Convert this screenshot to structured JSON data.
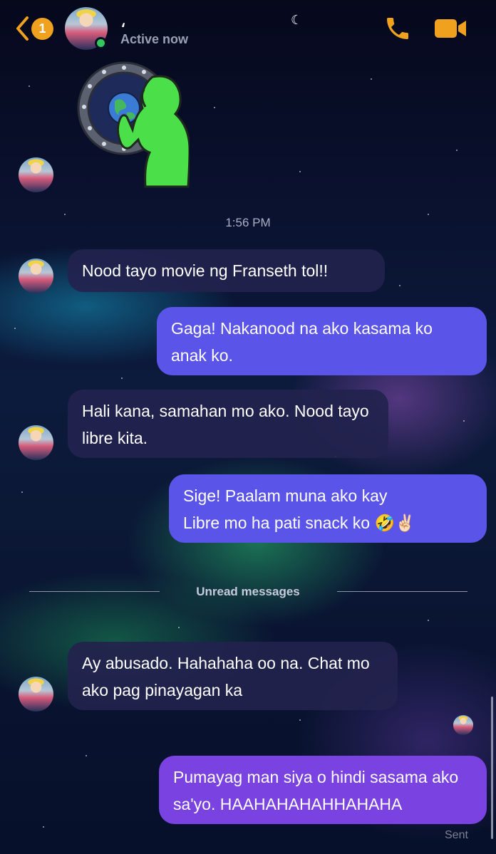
{
  "header": {
    "unread_count": "1",
    "contact_name": "⸲",
    "status": "Active now",
    "moon": "☾",
    "back_icon": "chevron-left-icon",
    "call_icon": "phone-icon",
    "video_icon": "video-camera-icon",
    "accent_color": "#f0a11e"
  },
  "timestamp": "1:56 PM",
  "divider": "Unread messages",
  "messages": [
    {
      "from": "them",
      "text": "Nood tayo movie ng Franseth tol!!"
    },
    {
      "from": "me",
      "text": "Gaga! Nakanood na ako kasama ko anak ko."
    },
    {
      "from": "them",
      "text": "Hali kana, samahan mo ako. Nood tayo libre kita."
    },
    {
      "from": "me",
      "text": "Sige! Paalam muna ako kay Libre mo ha pati snack ko 🤣✌🏻"
    },
    {
      "from": "them",
      "text": "Ay abusado. Hahahaha oo na. Chat mo ako pag pinayagan ka"
    },
    {
      "from": "me",
      "text": "Pumayag man siya o hindi sasama ako sa'yo. HAAHAHAHAHHAHAHA"
    }
  ],
  "receipt": "Sent"
}
